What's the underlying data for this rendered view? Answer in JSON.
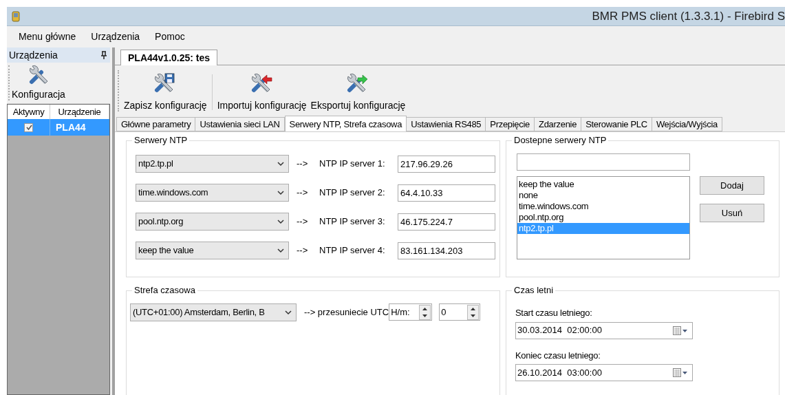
{
  "window": {
    "title": "BMR PMS client (1.3.3.1) - Firebird S"
  },
  "menu": [
    "Menu główne",
    "Urządzenia",
    "Pomoc"
  ],
  "devices_panel": {
    "title": "Urządzenia",
    "tool": "Konfiguracja",
    "columns": [
      "Aktywny",
      "Urządzenie"
    ],
    "rows": [
      {
        "checked": true,
        "name": "PLA44",
        "selected": true
      }
    ]
  },
  "document_tab": {
    "label": "PLA44v1.0.25: tes",
    "selected": true
  },
  "toolbar": [
    {
      "kind": "save",
      "label": "Zapisz konfigurację"
    },
    {
      "kind": "import",
      "label": "Importuj konfigurację"
    },
    {
      "kind": "export",
      "label": "Eksportuj konfigurację"
    }
  ],
  "tabs": [
    {
      "label": "Główne parametry",
      "selected": false
    },
    {
      "label": "Ustawienia sieci LAN",
      "selected": false
    },
    {
      "label": "Serwery NTP, Strefa czasowa",
      "selected": true
    },
    {
      "label": "Ustawienia RS485",
      "selected": false
    },
    {
      "label": "Przepięcie",
      "selected": false
    },
    {
      "label": "Zdarzenie",
      "selected": false
    },
    {
      "label": "Sterowanie PLC",
      "selected": false
    },
    {
      "label": "Wejścia/Wyjścia",
      "selected": false
    }
  ],
  "ntp_servers": {
    "title": "Serwery NTP",
    "rows": [
      {
        "server": "ntp2.tp.pl",
        "arrow": "-->",
        "label": "NTP IP server 1:",
        "ip": "217.96.29.26"
      },
      {
        "server": "time.windows.com",
        "arrow": "-->",
        "label": "NTP IP server 2:",
        "ip": "64.4.10.33"
      },
      {
        "server": "pool.ntp.org",
        "arrow": "-->",
        "label": "NTP IP server 3:",
        "ip": "46.175.224.7"
      },
      {
        "server": "keep the value",
        "arrow": "-->",
        "label": "NTP IP server 4:",
        "ip": "83.161.134.203"
      }
    ]
  },
  "available_servers": {
    "title": "Dostepne serwery NTP",
    "items": [
      {
        "label": "keep the value",
        "selected": false
      },
      {
        "label": "none",
        "selected": false
      },
      {
        "label": "time.windows.com",
        "selected": false
      },
      {
        "label": "pool.ntp.org",
        "selected": false
      },
      {
        "label": "ntp2.tp.pl",
        "selected": true
      }
    ],
    "buttons": [
      "Dodaj",
      "Usuń"
    ]
  },
  "timezone": {
    "title": "Strefa czasowa",
    "zone": "(UTC+01:00) Amsterdam, Berlin, B",
    "offset_label": "--> przesuniecie UTC",
    "hours": "H/m:",
    "minutes": "0"
  },
  "daylight_saving": {
    "title": "Czas letni",
    "fields": [
      {
        "label": "Start czasu letniego:",
        "value": "30.03.2014  02:00:00"
      },
      {
        "label": "Koniec czasu letniego:",
        "value": "26.10.2014  03:00:00"
      }
    ]
  }
}
